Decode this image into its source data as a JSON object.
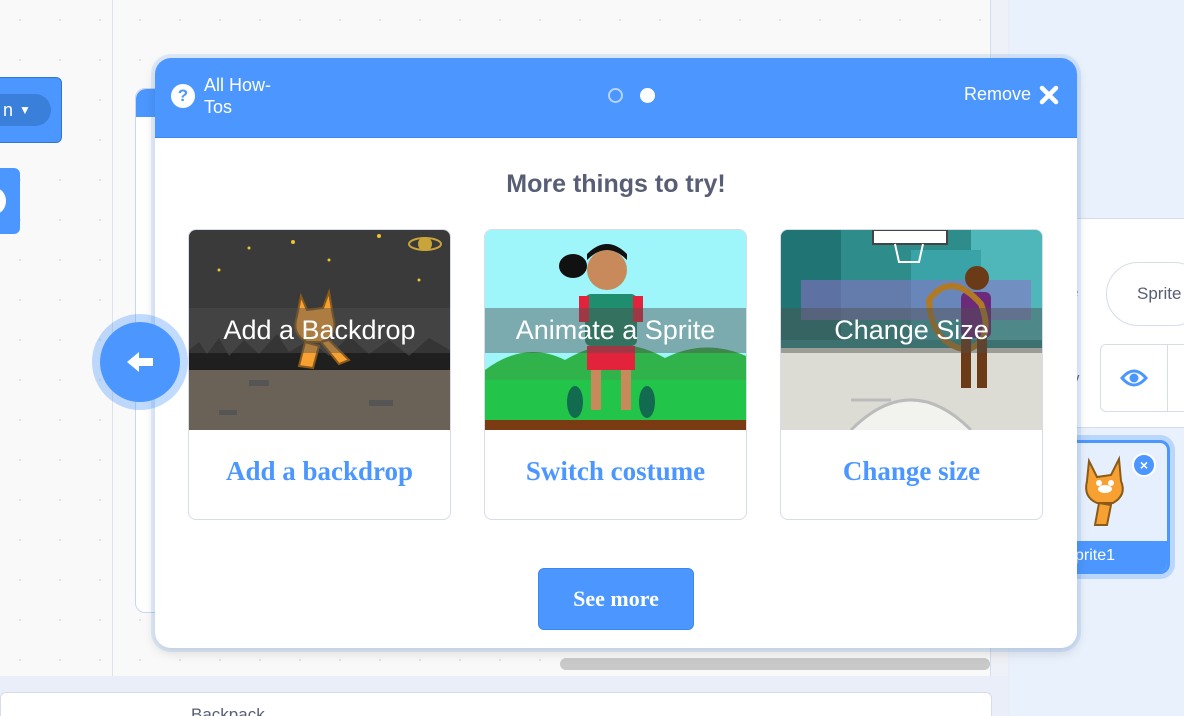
{
  "workspace": {
    "dropdown_block_text": "n",
    "backpack_label": "Backpack"
  },
  "sprite_pane": {
    "sprite_label": "e",
    "sprite_name_value": "Sprite",
    "show_label": "v",
    "sprite_tile_name": "prite1",
    "delete_symbol": "×"
  },
  "howto_card": {
    "all_howtos_label": "All How-Tos",
    "help_symbol": "?",
    "steps": {
      "total": 2,
      "active": 2
    },
    "remove_label": "Remove",
    "title": "More things to try!",
    "tiles": [
      {
        "overlay": "Add a Backdrop",
        "caption": "Add a backdrop"
      },
      {
        "overlay": "Animate a Sprite",
        "caption": "Switch costume"
      },
      {
        "overlay": "Change Size",
        "caption": "Change size"
      }
    ],
    "see_more_label": "See more"
  },
  "colors": {
    "accent": "#4c97ff",
    "text": "#575e75",
    "border": "#d6dcea"
  },
  "icons": {
    "help": "question-circle-icon",
    "remove": "close-icon",
    "back": "back-arrow-icon",
    "visibility": "eye-icon",
    "dropdown": "caret-down-icon"
  }
}
